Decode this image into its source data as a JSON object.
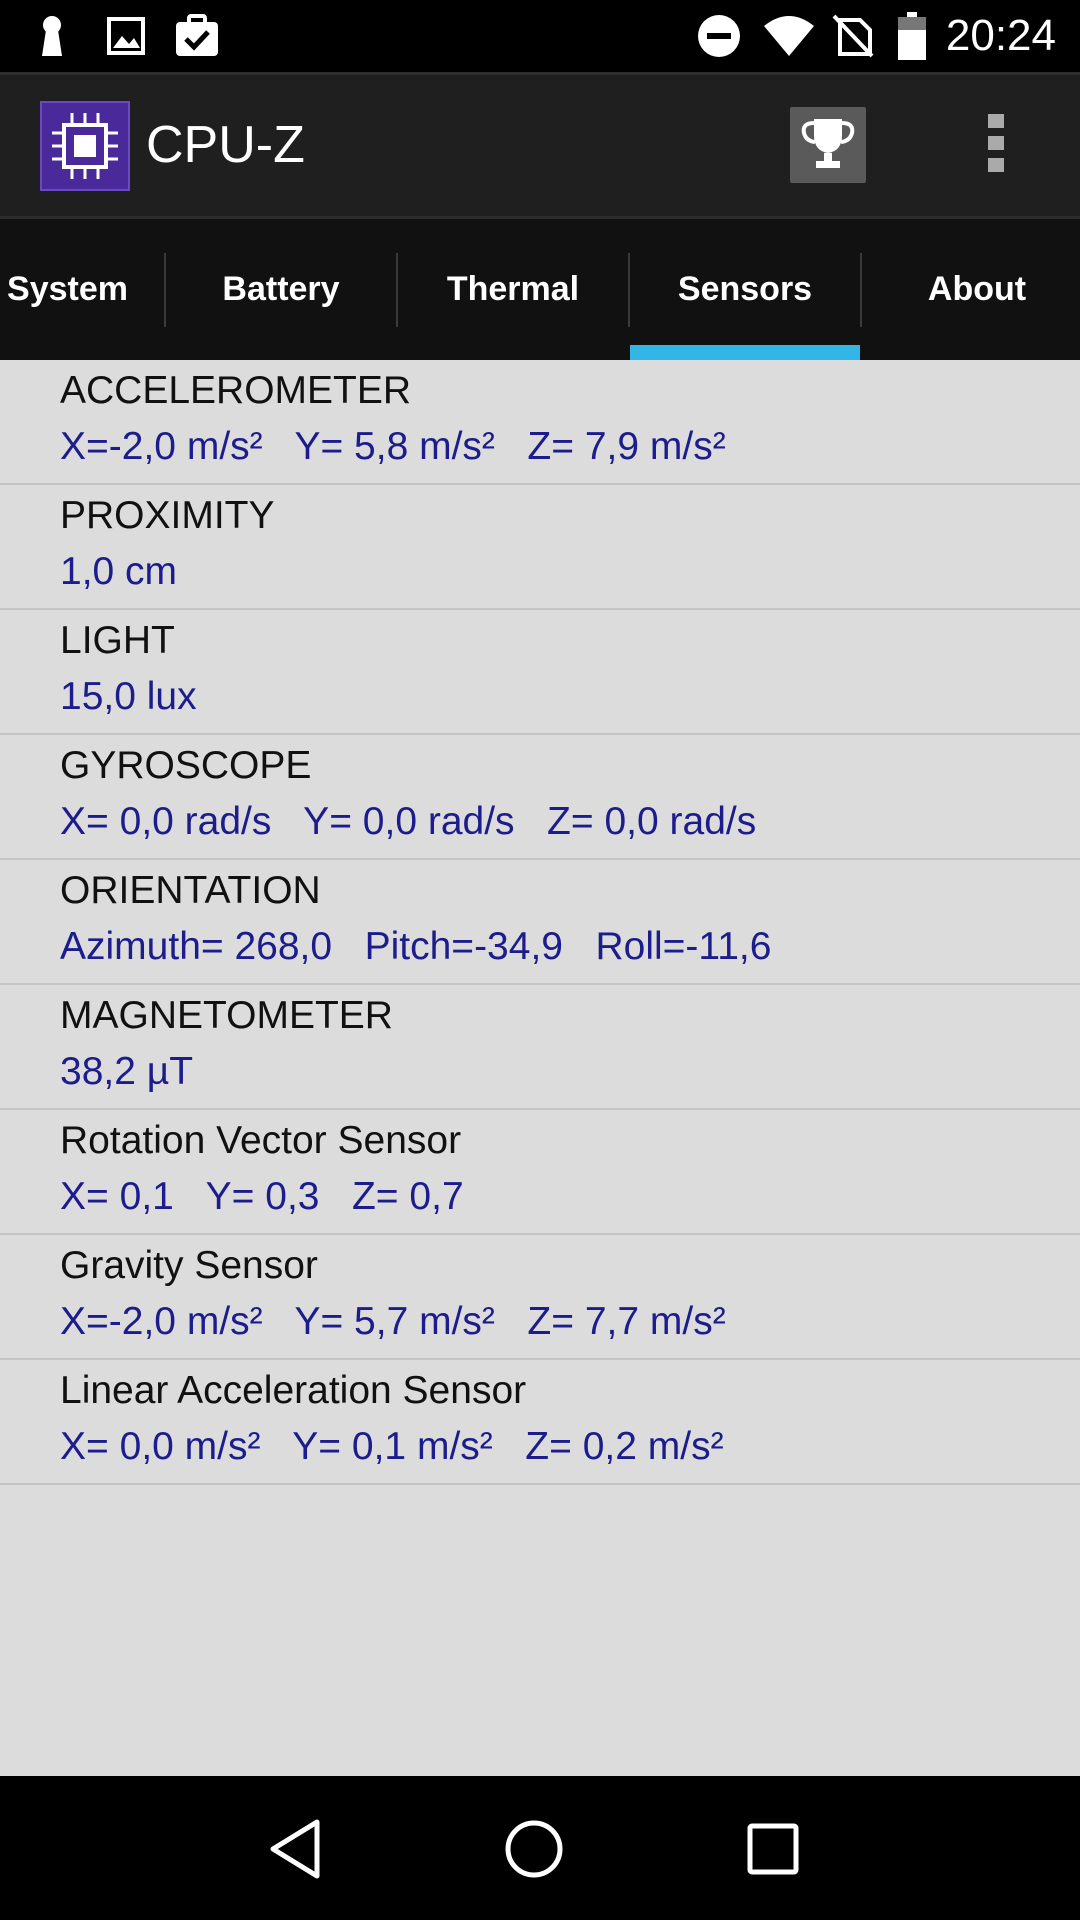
{
  "status_bar": {
    "time": "20:24",
    "icons": [
      "keyhole-icon",
      "image-icon",
      "clipboard-check-icon",
      "do-not-disturb-icon",
      "wifi-icon",
      "no-sim-icon",
      "battery-icon"
    ]
  },
  "app_bar": {
    "title": "CPU-Z",
    "logo": "cpu-chip-icon",
    "actions": [
      "trophy-icon",
      "overflow-menu-icon"
    ]
  },
  "tabs": [
    {
      "label": "System"
    },
    {
      "label": "Battery"
    },
    {
      "label": "Thermal"
    },
    {
      "label": "Sensors",
      "selected": true
    },
    {
      "label": "About"
    }
  ],
  "sensors": [
    {
      "name": "ACCELEROMETER",
      "value": "X=-2,0 m/s²   Y= 5,8 m/s²   Z= 7,9 m/s²"
    },
    {
      "name": "PROXIMITY",
      "value": "1,0 cm"
    },
    {
      "name": "LIGHT",
      "value": "15,0 lux"
    },
    {
      "name": "GYROSCOPE",
      "value": "X= 0,0 rad/s   Y= 0,0 rad/s   Z= 0,0 rad/s"
    },
    {
      "name": "ORIENTATION",
      "value": "Azimuth= 268,0   Pitch=-34,9   Roll=-11,6"
    },
    {
      "name": "MAGNETOMETER",
      "value": "38,2 µT"
    },
    {
      "name": "Rotation Vector Sensor",
      "value": "X= 0,1   Y= 0,3   Z= 0,7"
    },
    {
      "name": "Gravity Sensor",
      "value": "X=-2,0 m/s²   Y= 5,7 m/s²   Z= 7,7 m/s²"
    },
    {
      "name": "Linear Acceleration Sensor",
      "value": "X= 0,0 m/s²   Y= 0,1 m/s²   Z= 0,2 m/s²"
    }
  ],
  "nav_bar": {
    "buttons": [
      "back-icon",
      "home-icon",
      "recents-icon"
    ]
  },
  "colors": {
    "accent": "#33b5e5",
    "value_text": "#1c1c8c",
    "content_bg": "#dcdcdc"
  }
}
